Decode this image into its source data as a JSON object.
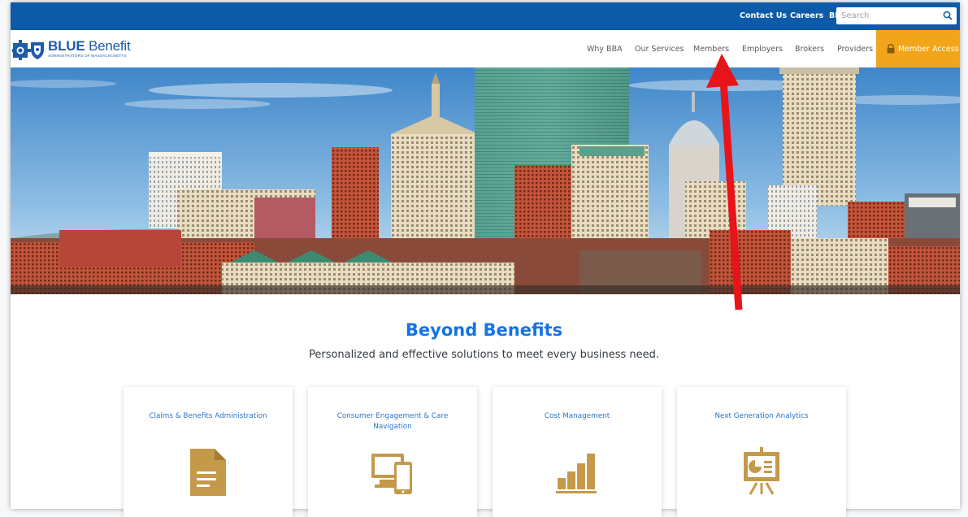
{
  "utility": {
    "links": [
      {
        "label": "Contact Us"
      },
      {
        "label": "Careers"
      },
      {
        "label": "Blog"
      }
    ],
    "search": {
      "placeholder": "Search",
      "value": ""
    }
  },
  "header": {
    "logo": {
      "main_bold": "BLUE",
      "main_rest": " Benefit",
      "sub": "ADMINISTRATORS OF MASSACHUSETTS"
    },
    "nav": [
      {
        "label": "Why BBA"
      },
      {
        "label": "Our Services"
      },
      {
        "label": "Members"
      },
      {
        "label": "Employers"
      },
      {
        "label": "Brokers"
      },
      {
        "label": "Providers"
      }
    ],
    "member_access": "Member Access"
  },
  "intro": {
    "headline": "Beyond Benefits",
    "subheadline": "Personalized and effective solutions to meet every business need."
  },
  "cards": [
    {
      "title": "Claims & Benefits Administration",
      "icon": "document-icon"
    },
    {
      "title": "Consumer Engagement & Care Navigation",
      "icon": "devices-icon"
    },
    {
      "title": "Cost Management",
      "icon": "bar-chart-icon"
    },
    {
      "title": "Next Generation Analytics",
      "icon": "presentation-icon"
    }
  ],
  "colors": {
    "utility_bar": "#0d5ba8",
    "brand_blue": "#1d5ca8",
    "accent_orange": "#f2a51b",
    "headline_blue": "#1473e6",
    "icon_gold": "#c49a4a",
    "annotation_arrow": "#e8141a"
  }
}
